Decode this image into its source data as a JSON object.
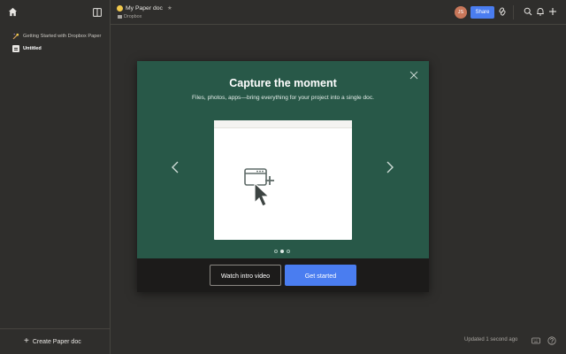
{
  "sidebar": {
    "items": [
      {
        "label": "Getting Started with Dropbox Paper",
        "icon": "sparkle-icon"
      },
      {
        "label": "Untitled",
        "icon": "doc-icon"
      }
    ],
    "create_label": "Create Paper doc"
  },
  "header": {
    "title": "My Paper doc",
    "breadcrumb": "Dropbox",
    "avatar_initials": "JS",
    "share_label": "Share"
  },
  "modal": {
    "title": "Capture the moment",
    "subtitle": "Files, photos, apps—bring everything for your project into a single doc.",
    "watch_label": "Watch intro video",
    "start_label": "Get started",
    "dots": 3,
    "active_dot": 2
  },
  "footer": {
    "status": "Updated 1 second ago"
  },
  "colors": {
    "accent": "#4a7df0",
    "modal_bg": "#285848",
    "avatar": "#c8775a"
  }
}
